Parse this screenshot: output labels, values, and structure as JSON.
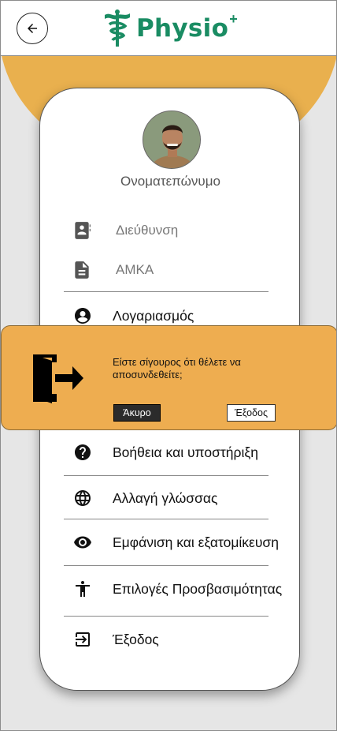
{
  "header": {
    "back_icon": "arrow-left-icon",
    "logo_text": "Physio",
    "logo_sup": "+",
    "logo_icon": "caduceus-icon",
    "brand_color": "#1a8c63"
  },
  "profile": {
    "name": "Ονοματεπώνυμο",
    "address_label": "Διεύθυνση",
    "address_icon": "contact-book-icon",
    "amka_label": "ΑΜΚΑ",
    "amka_icon": "document-icon"
  },
  "menu": {
    "account": "Λογαριασμός",
    "help": "Βοήθεια και υποστήριξη",
    "language": "Αλλαγή γλώσσας",
    "appearance": "Εμφάνιση και εξατομίκευση",
    "accessibility": "Επιλογές Προσβασιμότητας",
    "logout": "Έξοδος"
  },
  "dialog": {
    "message": "Είστε σίγουρος ότι θέλετε να αποσυνδεθείτε;",
    "cancel_label": "Άκυρο",
    "confirm_label": "Έξοδος",
    "icon": "logout-door-icon"
  },
  "colors": {
    "accent_orange": "#e9b04e",
    "dialog_orange": "#eead50",
    "background": "#e6e6e6"
  }
}
